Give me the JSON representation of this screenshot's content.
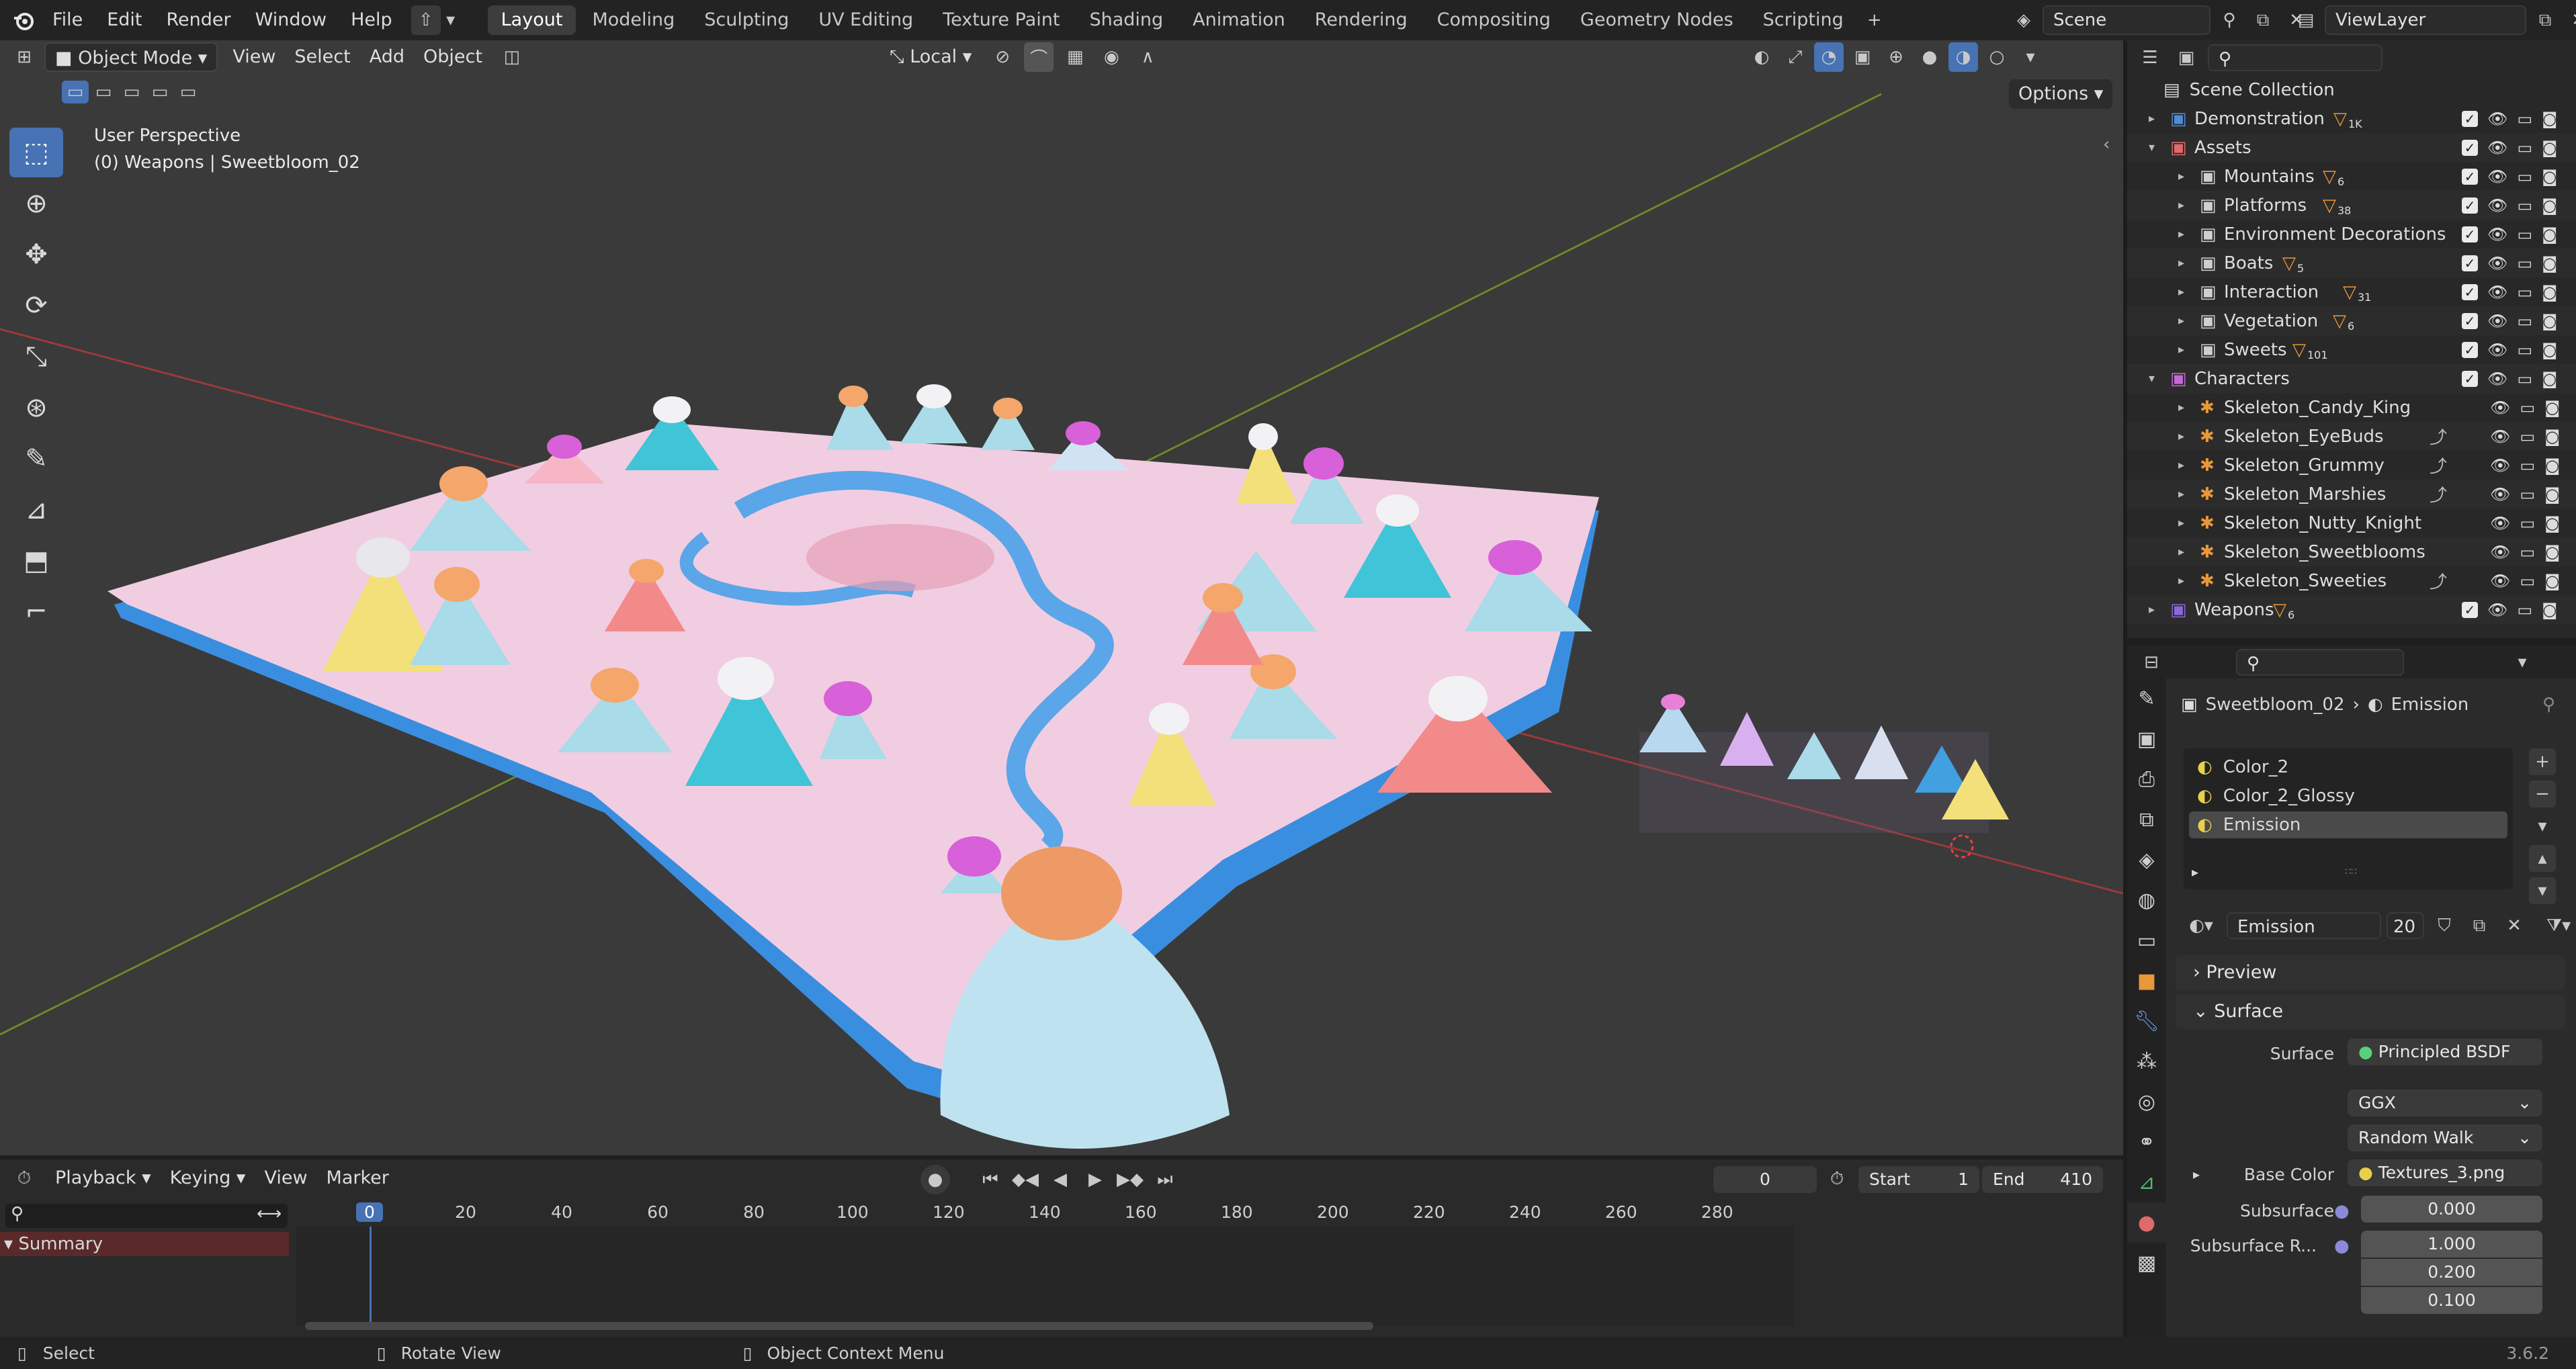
{
  "topbar": {
    "menus": [
      "File",
      "Edit",
      "Render",
      "Window",
      "Help"
    ],
    "workspaces": [
      "Layout",
      "Modeling",
      "Sculpting",
      "UV Editing",
      "Texture Paint",
      "Shading",
      "Animation",
      "Rendering",
      "Compositing",
      "Geometry Nodes",
      "Scripting"
    ],
    "active_workspace": "Layout",
    "scene": "Scene",
    "view_layer": "ViewLayer"
  },
  "viewport": {
    "mode": "Object Mode",
    "menus": [
      "View",
      "Select",
      "Add",
      "Object"
    ],
    "transform_orientation": "Local",
    "options_label": "Options",
    "overlay_title": "User Perspective",
    "overlay_subtitle": "(0) Weapons | Sweetbloom_02",
    "tools": [
      "select-box",
      "cursor",
      "move",
      "rotate",
      "scale",
      "transform",
      "annotate",
      "measure",
      "add-cube",
      "shear"
    ]
  },
  "outliner": {
    "search_placeholder": "",
    "root": "Scene Collection",
    "rows": [
      {
        "name": "Demonstration",
        "count": "1K",
        "depth": 1,
        "kind": "collection",
        "expanded": false,
        "color": "#4e8dd6"
      },
      {
        "name": "Assets",
        "count": "",
        "depth": 1,
        "kind": "collection",
        "expanded": true,
        "color": "#e06a6a"
      },
      {
        "name": "Mountains",
        "count": "6",
        "depth": 2,
        "kind": "collection",
        "color": "#cfcfcf"
      },
      {
        "name": "Platforms",
        "count": "38",
        "depth": 2,
        "kind": "collection",
        "color": "#cfcfcf"
      },
      {
        "name": "Environment Decorations",
        "count": "",
        "depth": 2,
        "kind": "collection",
        "color": "#cfcfcf"
      },
      {
        "name": "Boats",
        "count": "5",
        "depth": 2,
        "kind": "collection",
        "color": "#cfcfcf"
      },
      {
        "name": "Interaction",
        "count": "31",
        "depth": 2,
        "kind": "collection",
        "color": "#cfcfcf"
      },
      {
        "name": "Vegetation",
        "count": "6",
        "depth": 2,
        "kind": "collection",
        "color": "#cfcfcf"
      },
      {
        "name": "Sweets",
        "count": "101",
        "depth": 2,
        "kind": "collection",
        "color": "#cfcfcf"
      },
      {
        "name": "Characters",
        "count": "",
        "depth": 1,
        "kind": "collection",
        "expanded": true,
        "color": "#c46ad6"
      },
      {
        "name": "Skeleton_Candy_King",
        "count": "",
        "depth": 2,
        "kind": "armature"
      },
      {
        "name": "Skeleton_EyeBuds",
        "count": "",
        "depth": 2,
        "kind": "armature"
      },
      {
        "name": "Skeleton_Grummy",
        "count": "",
        "depth": 2,
        "kind": "armature"
      },
      {
        "name": "Skeleton_Marshies",
        "count": "",
        "depth": 2,
        "kind": "armature"
      },
      {
        "name": "Skeleton_Nutty_Knight",
        "count": "",
        "depth": 2,
        "kind": "armature"
      },
      {
        "name": "Skeleton_Sweetblooms",
        "count": "",
        "depth": 2,
        "kind": "armature"
      },
      {
        "name": "Skeleton_Sweeties",
        "count": "",
        "depth": 2,
        "kind": "armature"
      },
      {
        "name": "Weapons",
        "count": "6",
        "depth": 1,
        "kind": "collection",
        "expanded": false,
        "color": "#8a6ad6"
      }
    ]
  },
  "properties": {
    "breadcrumb_object": "Sweetbloom_02",
    "breadcrumb_material": "Emission",
    "slots": [
      "Color_2",
      "Color_2_Glossy",
      "Emission"
    ],
    "active_slot": "Emission",
    "material_name": "Emission",
    "material_users": "20",
    "panel_preview": "Preview",
    "panel_surface": "Surface",
    "surface_label": "Surface",
    "surface_value": "Principled BSDF",
    "distribution": "GGX",
    "subsurface_method": "Random Walk",
    "base_color_label": "Base Color",
    "base_color_value": "Textures_3.png",
    "subsurface_label": "Subsurface",
    "subsurface_value": "0.000",
    "subsurface_radius_label": "Subsurface R...",
    "subsurface_radius": [
      "1.000",
      "0.200",
      "0.100"
    ]
  },
  "timeline": {
    "menus": [
      "Playback",
      "Keying",
      "View",
      "Marker"
    ],
    "current_frame": "0",
    "start_label": "Start",
    "start_value": "1",
    "end_label": "End",
    "end_value": "410",
    "ruler": [
      "0",
      "20",
      "40",
      "60",
      "80",
      "100",
      "120",
      "140",
      "160",
      "180",
      "200",
      "220",
      "240",
      "260",
      "280"
    ],
    "summary_label": "Summary"
  },
  "statusbar": {
    "left": "Select",
    "middle": "Rotate View",
    "right": "Object Context Menu",
    "version": "3.6.2"
  }
}
